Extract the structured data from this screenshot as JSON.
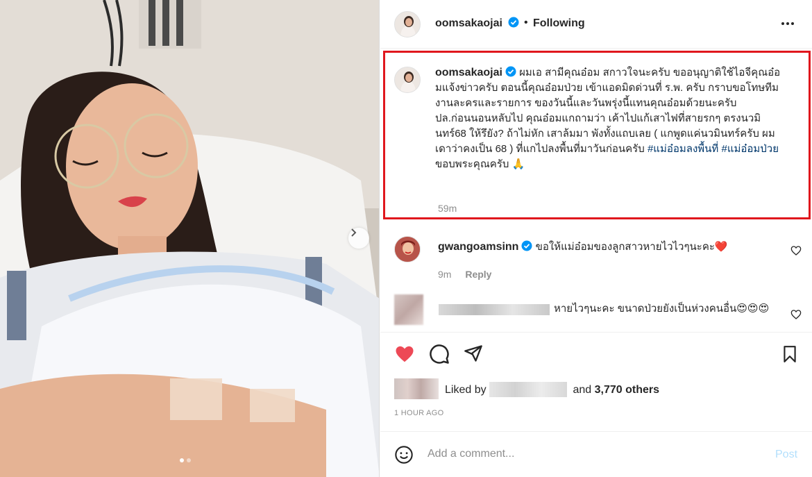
{
  "post": {
    "author": "oomsakaojai",
    "follow_status": "Following",
    "separator": "•",
    "more_icon": "more-horizontal-icon",
    "carousel_slide": 1,
    "carousel_count": 2
  },
  "caption": {
    "username": "oomsakaojai",
    "text": "ผมเอ สามีคุณอ๋อม สกาวใจนะครับ ขออนุญาติใช้ไอจีคุณอ๋อมแจ้งข่าวครับ ตอนนี้คุณอ๋อมป่วย เข้าแอดมิดด่วนที่ ร.พ. ครับ กราบขอโทษทีมงานละครและรายการ ของวันนี้และวันพรุ่งนี้แทนคุณอ๋อมด้วยนะครับ\nปล.ก่อนนอนหลับไป คุณอ๋อมแกถามว่า เค้าไปแก้เสาไฟที่สายรกๆ ตรงนวมินทร์68 ให้รึยัง? ถ้าไม่หัก เสาล้มมา พังทั้งแถบเลย ( แกพูดแค่นวมินทร์ครับ ผมเดาว่าคงเป็น 68 ) ที่แกไปลงพื้นที่มาวันก่อนครับ ",
    "hashtag1": "#แม่อ๋อมลงพื้นที่",
    "hashtag2": "#แม่อ๋อมป่วย",
    "tail": " ขอบพระคุณครับ 🙏",
    "time": "59m"
  },
  "comments": [
    {
      "username": "gwangoamsinn",
      "text": "ขอให้แม่อ๋อมของลูกสาวหายไวไวๆนะคะ❤️",
      "time": "9m",
      "reply_label": "Reply"
    },
    {
      "text": "หายไวๆนะคะ ขนาดป่วยยังเป็นห่วงคนอื่น😍😍😍"
    }
  ],
  "likes": {
    "prefix": "Liked by",
    "and_label": "and",
    "others": "3,770 others"
  },
  "posted": "1 HOUR AGO",
  "add_comment": {
    "placeholder": "Add a comment...",
    "post_label": "Post"
  },
  "colors": {
    "heart": "#ed4956",
    "highlight_border": "#e0171d",
    "verified": "#0095f6",
    "hashtag": "#00376b",
    "post_button": "#b2dffc"
  }
}
